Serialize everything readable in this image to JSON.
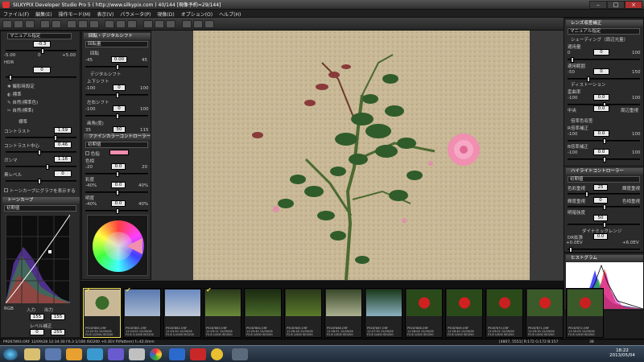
{
  "window": {
    "title": "SILKYPIX Developer Studio Pro 5 ( http://www.silkypix.com )  40/144 [現像予約=29/144]"
  },
  "menu": [
    "ファイル(F)",
    "編集(E)",
    "操作モード(M)",
    "表示(V)",
    "パラメータ(P)",
    "現像(D)",
    "オプション(O)",
    "ヘルプ(H)"
  ],
  "left_panel": {
    "preset": "マニュアル指定",
    "wb_value": "-0.3",
    "wb_min": "-5.00",
    "wb_mid": "0",
    "wb_max": "+5.00",
    "hdr_label": "HDR",
    "hdr_value": "0",
    "rows": [
      "撮影時設定",
      "標準",
      "自然(標準色)",
      "自然(標準)"
    ],
    "tone_label": "標準",
    "contrast_label": "コントラスト",
    "contrast_value": "1.59",
    "contrast_center_label": "コントラスト中心",
    "contrast_center_value": "0.46",
    "gamma_label": "ガンマ",
    "gamma_value": "1.16",
    "black_label": "黒レベル",
    "black_value": "0",
    "tonecurve_checkbox": "トーンカーブにグラフを表示する",
    "tonecurve_title": "トーンカーブ",
    "tonecurve_mode": "初期値",
    "rgb_label": "RGB",
    "in_label": "入力",
    "out_label": "出力",
    "in_value": "155",
    "out_value": "155",
    "level_label": "レベル補正",
    "level_low": "0",
    "level_high": "255"
  },
  "mid_panel": {
    "rotation_title": "回転・デジタルシフト",
    "rotation_mode": "回転量",
    "rotation_sub": "回転",
    "rotation_min": "-45",
    "rotation_value": "0.00",
    "rotation_max": "45",
    "shift_title": "デジタルシフト",
    "shift_up_label": "上下シフト",
    "shift_up_min": "-100",
    "shift_up_value": "0",
    "shift_up_max": "100",
    "shift_lr_label": "左右シフト",
    "shift_lr_min": "-100",
    "shift_lr_value": "0",
    "shift_lr_max": "100",
    "focal_label": "画角(度)",
    "focal_min": "35",
    "focal_value": "50",
    "focal_max": "115",
    "fine_title": "ファインカラーコントローラー",
    "fine_mode": "初期値",
    "fine_color_label": "色指",
    "hue_label": "色相",
    "hue_min": "-20",
    "hue_value": "0.0",
    "hue_max": "20",
    "sat_label": "彩度",
    "sat_min": "-40%",
    "sat_value": "0.0",
    "sat_max": "40%",
    "lum_label": "明度",
    "lum_min": "-40%",
    "lum_value": "0.0",
    "lum_max": "40%"
  },
  "right_panel": {
    "lens_title": "レンズ収差補正",
    "lens_mode": "マニュアル指定",
    "shading_title": "シェーディング（周辺光量）",
    "shading_amount_label": "適用量",
    "shading_amount_min": "0",
    "shading_amount_value": "0",
    "shading_amount_max": "100",
    "shading_range_label": "適用範囲",
    "shading_range_min": "-50",
    "shading_range_value": "0",
    "shading_range_max": "150",
    "distortion_title": "ディストーション",
    "distortion_label": "歪曲率",
    "distortion_min": "-100",
    "distortion_value": "0.0",
    "distortion_max": "100",
    "distortion_sub": "中央",
    "distortion_sub_right": "周辺重視",
    "ca_title": "倍率色収差",
    "ca_r_label": "R倍率補正",
    "ca_r_min": "-100",
    "ca_r_value": "0.0",
    "ca_r_max": "100",
    "ca_b_label": "B倍率補正",
    "ca_b_min": "-100",
    "ca_b_value": "0.0",
    "ca_b_max": "100",
    "hl_title": "ハイライトコントローラー",
    "hl_mode": "初期値",
    "hl_color_label": "色彩重視",
    "hl_color_value": "25",
    "hl_color_right": "輝度重視",
    "hl_apply_label": "輝度重視",
    "hl_apply_value": "0",
    "hl_apply_right": "色相重視",
    "hl_mix_label": "明暗強度",
    "hl_mix_value": "50",
    "dr_title": "ダイナミックレンジ",
    "dr_label": "DR拡張",
    "dr_min": "+0.0EV",
    "dr_value": "0.0",
    "dr_max": "+6.0EV",
    "hist_title": "ヒストグラム"
  },
  "thumbnails": [
    {
      "name": "P9267860.ORF",
      "line2": "11:22:34 12/09/26",
      "line3": "F2.8 1/250s ISO200",
      "checked": true
    },
    {
      "name": "P9267861.ORF",
      "line2": "11:24:02 12/09/26",
      "line3": "F2.8 1/1000 ISO200",
      "checked": true
    },
    {
      "name": "P9267862.ORF",
      "line2": "11:24:30 12/09/26",
      "line3": "F2.8 1/1000 ISO200",
      "checked": false
    },
    {
      "name": "P9267863.ORF",
      "line2": "11:25:11 12/09/26",
      "line3": "F2.8 1/500 ISO200",
      "checked": true
    },
    {
      "name": "P9267864.ORF",
      "line2": "11:25:40 12/09/26",
      "line3": "F2.8 1/500 ISO200",
      "checked": false
    },
    {
      "name": "P9267865.ORF",
      "line2": "11:26:18 12/09/26",
      "line3": "F2.8 1/500 ISO200",
      "checked": false
    },
    {
      "name": "P9267866.ORF",
      "line2": "11:26:51 12/09/26",
      "line3": "F2.8 1/500 ISO200",
      "checked": false
    },
    {
      "name": "P9267867.ORF",
      "line2": "11:27:30 12/09/26",
      "line3": "F2.8 1/400 ISO200",
      "checked": false
    },
    {
      "name": "P9267868.ORF",
      "line2": "11:28:04 12/09/26",
      "line3": "F2.8 1/320 ISO200",
      "checked": false
    },
    {
      "name": "P9267869.ORF",
      "line2": "11:28:40 12/09/26",
      "line3": "F2.8 1/500 ISO200",
      "checked": false
    },
    {
      "name": "P9267870.ORF",
      "line2": "11:29:02 12/09/26",
      "line3": "F2.8 1/500 ISO200",
      "checked": false
    },
    {
      "name": "P9267871.ORF",
      "line2": "11:29:30 12/09/26",
      "line3": "F2.8 1/500 ISO200",
      "checked": false
    },
    {
      "name": "P9267872.ORF",
      "line2": "11:30:05 12/09/26",
      "line3": "F2.8 1/500 ISO200",
      "checked": false
    }
  ],
  "status": {
    "left": "P9267893.ORF 12/09/28 12:34:30 F6.3 1/100 ISO200 +0.3EV P(Pattern) f=42.0mm",
    "right": "[4807, 5551] R:172 G:172 B:157",
    "zoom": "38"
  },
  "taskbar": {
    "time": "18:22",
    "date": "2013/05/04"
  },
  "colors": {
    "accent": "#e8d850",
    "rose": "#f08fb0",
    "wall": "#c9b99a"
  }
}
